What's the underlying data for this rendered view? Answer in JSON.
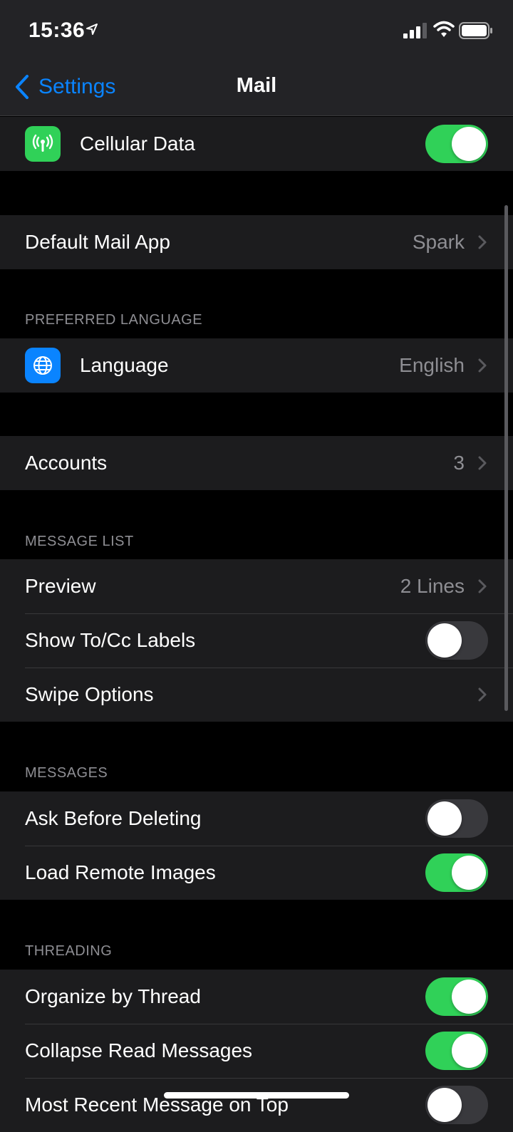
{
  "status": {
    "time": "15:36"
  },
  "nav": {
    "back_label": "Settings",
    "title": "Mail"
  },
  "cellular": {
    "label": "Cellular Data",
    "on": true
  },
  "default_mail": {
    "label": "Default Mail App",
    "value": "Spark"
  },
  "preferred_language": {
    "header": "PREFERRED LANGUAGE",
    "language_label": "Language",
    "language_value": "English"
  },
  "accounts": {
    "label": "Accounts",
    "value": "3"
  },
  "message_list": {
    "header": "MESSAGE LIST",
    "preview_label": "Preview",
    "preview_value": "2 Lines",
    "show_tocc_label": "Show To/Cc Labels",
    "show_tocc_on": false,
    "swipe_label": "Swipe Options"
  },
  "messages": {
    "header": "MESSAGES",
    "ask_before_deleting_label": "Ask Before Deleting",
    "ask_before_deleting_on": false,
    "load_remote_images_label": "Load Remote Images",
    "load_remote_images_on": true
  },
  "threading": {
    "header": "THREADING",
    "organize_label": "Organize by Thread",
    "organize_on": true,
    "collapse_label": "Collapse Read Messages",
    "collapse_on": true,
    "most_recent_label": "Most Recent Message on Top",
    "most_recent_on": false
  },
  "colors": {
    "accent": "#0a84ff",
    "toggle_on": "#30d158",
    "cellular_icon_bg": "#30d158",
    "language_icon_bg": "#0a84ff"
  },
  "icons": {
    "back": "chevron-left-icon",
    "cellular": "antenna-icon",
    "language": "globe-icon",
    "disclosure": "chevron-right-icon"
  }
}
